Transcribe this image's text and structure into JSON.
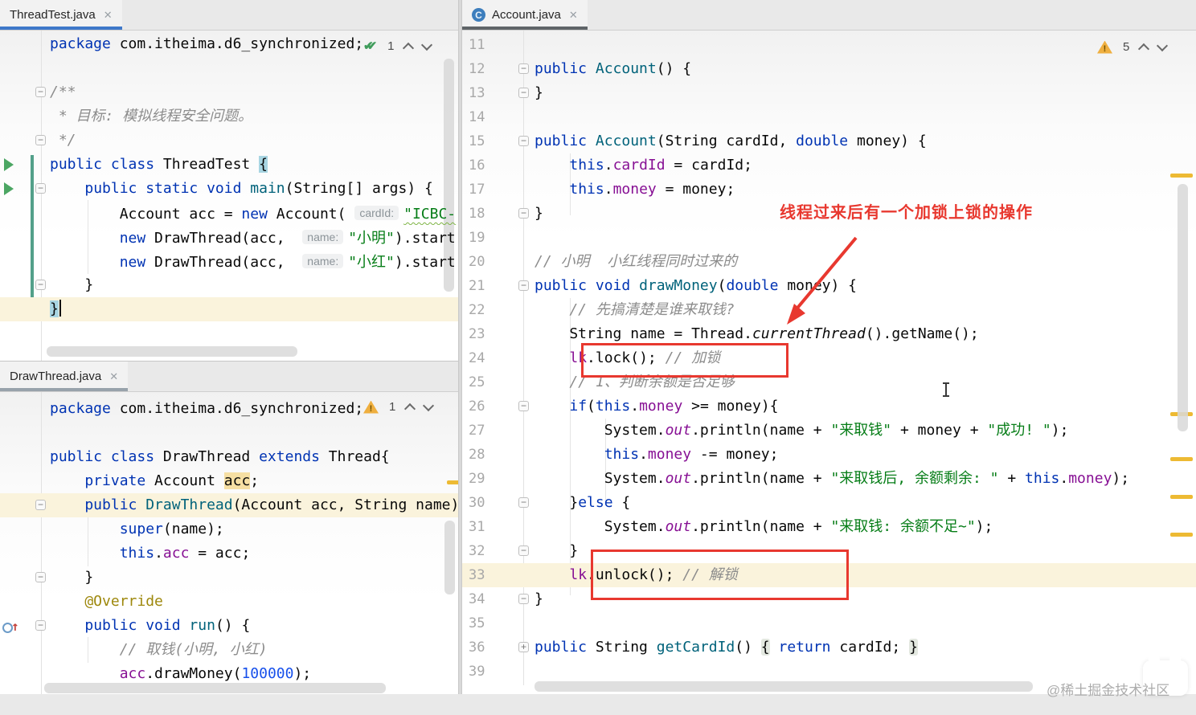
{
  "annotation": {
    "text": "线程过来后有一个加锁上锁的操作"
  },
  "watermark": "@稀土掘金技术社区",
  "icons": {
    "close": "✕",
    "check": "✔✔",
    "warning_mark": "!",
    "class_badge": "C",
    "fold_minus": "−",
    "fold_plus": "+",
    "override_arrow": "↑"
  },
  "colors": {
    "annotation_red": "#E8382F",
    "warning_yellow": "#EFAF3F",
    "stripe_yellow": "#EDBA33",
    "run_green": "#4CA663",
    "vcs_teal": "#53A08A",
    "active_tab_blue": "#3E78C9"
  },
  "editors": {
    "threadtest": {
      "tab": "ThreadTest.java",
      "inspection_count": "1",
      "gw": 62,
      "foldx": 44,
      "lines": [
        {
          "tk": [
            [
              "k",
              "package"
            ],
            [
              "t",
              " com.itheima.d6_synchronized;"
            ]
          ]
        },
        {
          "tk": []
        },
        {
          "g": [
            "fd"
          ],
          "tk": [
            [
              "c",
              "/**"
            ]
          ]
        },
        {
          "tk": [
            [
              "c",
              " * 目标: 模拟线程安全问题。"
            ]
          ]
        },
        {
          "g": [
            "fu"
          ],
          "tk": [
            [
              "c",
              " */"
            ]
          ]
        },
        {
          "g": [
            "run"
          ],
          "tk": [
            [
              "k",
              "public class"
            ],
            [
              "t",
              " ThreadTest "
            ],
            [
              "bh",
              "{"
            ]
          ]
        },
        {
          "g": [
            "run",
            "fd"
          ],
          "tk": [
            [
              "t",
              "    "
            ],
            [
              "k",
              "public static void"
            ],
            [
              "t",
              " "
            ],
            [
              "m",
              "main"
            ],
            [
              "t",
              "(String[] args) {"
            ]
          ]
        },
        {
          "tk": [
            [
              "t",
              "        Account acc = "
            ],
            [
              "k",
              "new"
            ],
            [
              "t",
              " Account( "
            ],
            [
              "h",
              "cardId:"
            ],
            [
              "sw",
              "\"ICBC-"
            ]
          ]
        },
        {
          "tk": [
            [
              "t",
              "        "
            ],
            [
              "k",
              "new"
            ],
            [
              "t",
              " DrawThread(acc,  "
            ],
            [
              "h",
              "name:"
            ],
            [
              "s",
              "\"小明\""
            ],
            [
              "t",
              ").start"
            ]
          ]
        },
        {
          "tk": [
            [
              "t",
              "        "
            ],
            [
              "k",
              "new"
            ],
            [
              "t",
              " DrawThread(acc,  "
            ],
            [
              "h",
              "name:"
            ],
            [
              "s",
              "\"小红\""
            ],
            [
              "t",
              ").start"
            ]
          ]
        },
        {
          "g": [
            "fu"
          ],
          "tk": [
            [
              "t",
              "    }"
            ]
          ]
        },
        {
          "hl": true,
          "caret": true,
          "tk": [
            [
              "bh",
              "}"
            ]
          ]
        }
      ]
    },
    "drawthread": {
      "tab": "DrawThread.java",
      "inspection_count": "1",
      "gw": 62,
      "foldx": 44,
      "lines": [
        {
          "tk": [
            [
              "k",
              "package"
            ],
            [
              "t",
              " com.itheima.d6_synchronized;"
            ]
          ]
        },
        {
          "tk": []
        },
        {
          "tk": [
            [
              "k",
              "public class"
            ],
            [
              "t",
              " DrawThread "
            ],
            [
              "k",
              "extends"
            ],
            [
              "t",
              " Thread{"
            ]
          ]
        },
        {
          "tk": [
            [
              "k",
              "    private"
            ],
            [
              "t",
              " Account "
            ],
            [
              "fh",
              "acc"
            ],
            [
              "t",
              ";"
            ]
          ]
        },
        {
          "hl": true,
          "g": [
            "fd"
          ],
          "tk": [
            [
              "k",
              "    public"
            ],
            [
              "t",
              " "
            ],
            [
              "m",
              "DrawThread"
            ],
            [
              "t",
              "(Account acc, String name)"
            ]
          ]
        },
        {
          "tk": [
            [
              "t",
              "        "
            ],
            [
              "k",
              "super"
            ],
            [
              "t",
              "(name);"
            ]
          ]
        },
        {
          "tk": [
            [
              "t",
              "        "
            ],
            [
              "k",
              "this"
            ],
            [
              "t",
              "."
            ],
            [
              "f",
              "acc"
            ],
            [
              "t",
              " = acc;"
            ]
          ]
        },
        {
          "g": [
            "fu"
          ],
          "tk": [
            [
              "t",
              "    }"
            ]
          ]
        },
        {
          "tk": [
            [
              "a",
              "    @Override"
            ]
          ]
        },
        {
          "g": [
            "ovr",
            "fd"
          ],
          "tk": [
            [
              "t",
              "    "
            ],
            [
              "k",
              "public void"
            ],
            [
              "t",
              " "
            ],
            [
              "m",
              "run"
            ],
            [
              "t",
              "() {"
            ]
          ]
        },
        {
          "tk": [
            [
              "c",
              "        // 取钱(小明, 小红)"
            ]
          ]
        },
        {
          "tk": [
            [
              "t",
              "        "
            ],
            [
              "f",
              "acc"
            ],
            [
              "t",
              ".drawMoney("
            ],
            [
              "n",
              "100000"
            ],
            [
              "t",
              ");"
            ]
          ]
        }
      ]
    },
    "account": {
      "tab": "Account.java",
      "inspection_count": "5",
      "gw": 90,
      "foldx": 70,
      "lines": [
        {
          "num": "11",
          "tk": []
        },
        {
          "num": "12",
          "g": [
            "fd"
          ],
          "tk": [
            [
              "k",
              "public"
            ],
            [
              "t",
              " "
            ],
            [
              "m",
              "Account"
            ],
            [
              "t",
              "() {"
            ]
          ]
        },
        {
          "num": "13",
          "g": [
            "fu"
          ],
          "tk": [
            [
              "t",
              "}"
            ]
          ]
        },
        {
          "num": "14",
          "tk": []
        },
        {
          "num": "15",
          "g": [
            "fd"
          ],
          "tk": [
            [
              "k",
              "public"
            ],
            [
              "t",
              " "
            ],
            [
              "m",
              "Account"
            ],
            [
              "t",
              "(String cardId, "
            ],
            [
              "k",
              "double"
            ],
            [
              "t",
              " money) {"
            ]
          ]
        },
        {
          "num": "16",
          "tk": [
            [
              "t",
              "    "
            ],
            [
              "k",
              "this"
            ],
            [
              "t",
              "."
            ],
            [
              "f",
              "cardId"
            ],
            [
              "t",
              " = cardId;"
            ]
          ]
        },
        {
          "num": "17",
          "tk": [
            [
              "t",
              "    "
            ],
            [
              "k",
              "this"
            ],
            [
              "t",
              "."
            ],
            [
              "f",
              "money"
            ],
            [
              "t",
              " = money;"
            ]
          ]
        },
        {
          "num": "18",
          "g": [
            "fu"
          ],
          "tk": [
            [
              "t",
              "}"
            ]
          ]
        },
        {
          "num": "19",
          "tk": []
        },
        {
          "num": "20",
          "tk": [
            [
              "c",
              "// 小明  小红线程同时过来的"
            ]
          ]
        },
        {
          "num": "21",
          "g": [
            "fd"
          ],
          "tk": [
            [
              "k",
              "public void"
            ],
            [
              "t",
              " "
            ],
            [
              "m",
              "drawMoney"
            ],
            [
              "t",
              "("
            ],
            [
              "k",
              "double"
            ],
            [
              "t",
              " money) {"
            ]
          ]
        },
        {
          "num": "22",
          "tk": [
            [
              "c",
              "    // 先搞清楚是谁来取钱?"
            ]
          ]
        },
        {
          "num": "23",
          "tk": [
            [
              "t",
              "    String name = Thread."
            ],
            [
              "i",
              "currentThread"
            ],
            [
              "t",
              "().getName();"
            ]
          ]
        },
        {
          "num": "24",
          "tk": [
            [
              "t",
              "    "
            ],
            [
              "f",
              "lk"
            ],
            [
              "t",
              ".lock(); "
            ],
            [
              "c",
              "// 加锁"
            ]
          ]
        },
        {
          "num": "25",
          "tk": [
            [
              "c",
              "    // 1、判断余额是否足够"
            ]
          ]
        },
        {
          "num": "26",
          "g": [
            "fd"
          ],
          "tk": [
            [
              "t",
              "    "
            ],
            [
              "k",
              "if"
            ],
            [
              "t",
              "("
            ],
            [
              "k",
              "this"
            ],
            [
              "t",
              "."
            ],
            [
              "f",
              "money"
            ],
            [
              "t",
              " >= money){"
            ]
          ]
        },
        {
          "num": "27",
          "tk": [
            [
              "t",
              "        System."
            ],
            [
              "fi",
              "out"
            ],
            [
              "t",
              ".println(name + "
            ],
            [
              "s",
              "\"来取钱\""
            ],
            [
              "t",
              " + money + "
            ],
            [
              "s",
              "\"成功! \""
            ],
            [
              "t",
              ");"
            ]
          ]
        },
        {
          "num": "28",
          "tk": [
            [
              "t",
              "        "
            ],
            [
              "k",
              "this"
            ],
            [
              "t",
              "."
            ],
            [
              "f",
              "money"
            ],
            [
              "t",
              " -= money;"
            ]
          ]
        },
        {
          "num": "29",
          "tk": [
            [
              "t",
              "        System."
            ],
            [
              "fi",
              "out"
            ],
            [
              "t",
              ".println(name + "
            ],
            [
              "s",
              "\"来取钱后, 余额剩余: \""
            ],
            [
              "t",
              " + "
            ],
            [
              "k",
              "this"
            ],
            [
              "t",
              "."
            ],
            [
              "f",
              "money"
            ],
            [
              "t",
              ");"
            ]
          ]
        },
        {
          "num": "30",
          "g": [
            "fd"
          ],
          "tk": [
            [
              "t",
              "    }"
            ],
            [
              "k",
              "else"
            ],
            [
              "t",
              " {"
            ]
          ]
        },
        {
          "num": "31",
          "tk": [
            [
              "t",
              "        System."
            ],
            [
              "fi",
              "out"
            ],
            [
              "t",
              ".println(name + "
            ],
            [
              "s",
              "\"来取钱: 余额不足~\""
            ],
            [
              "t",
              ");"
            ]
          ]
        },
        {
          "num": "32",
          "g": [
            "fu"
          ],
          "tk": [
            [
              "t",
              "    }"
            ]
          ]
        },
        {
          "num": "33",
          "hl": true,
          "tk": [
            [
              "t",
              "    "
            ],
            [
              "f",
              "lk"
            ],
            [
              "t",
              ".unlock(); "
            ],
            [
              "c",
              "// 解锁"
            ]
          ]
        },
        {
          "num": "34",
          "g": [
            "fu"
          ],
          "tk": [
            [
              "t",
              "}"
            ]
          ]
        },
        {
          "num": "35",
          "tk": []
        },
        {
          "num": "36",
          "g": [
            "fp"
          ],
          "tk": [
            [
              "k",
              "public"
            ],
            [
              "t",
              " String "
            ],
            [
              "m",
              "getCardId"
            ],
            [
              "t",
              "() "
            ],
            [
              "fb",
              "{"
            ],
            [
              "t",
              " "
            ],
            [
              "k",
              "return"
            ],
            [
              "t",
              " cardId; "
            ],
            [
              "fb",
              "}"
            ]
          ]
        },
        {
          "num": "39",
          "tk": []
        }
      ]
    }
  }
}
